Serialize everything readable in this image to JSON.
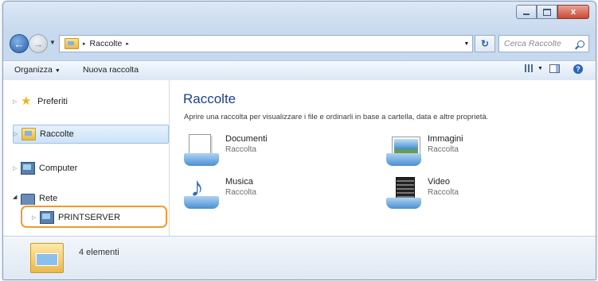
{
  "window": {
    "close_glyph": "x",
    "address": {
      "crumb": "Raccolte",
      "separator": "▸"
    },
    "search": {
      "placeholder": "Cerca Raccolte"
    }
  },
  "toolbar": {
    "organize": "Organizza",
    "new_collection": "Nuova raccolta",
    "dropdown_arrow": "▼"
  },
  "sidebar": {
    "items": [
      {
        "label": "Preferiti",
        "icon": "star-icon"
      },
      {
        "label": "Raccolte",
        "icon": "library-icon",
        "selected": true
      },
      {
        "label": "Computer",
        "icon": "computer-icon"
      },
      {
        "label": "Rete",
        "icon": "network-icon"
      },
      {
        "label": "PRINTSERVER",
        "icon": "computer-icon",
        "highlighted": true
      }
    ]
  },
  "content": {
    "title": "Raccolte",
    "description": "Aprire una raccolta per visualizzare i file e ordinarli in base a cartella, data e altre proprietà.",
    "libraries": [
      {
        "name": "Documenti",
        "type": "Raccolta",
        "icon": "documents-library-icon"
      },
      {
        "name": "Immagini",
        "type": "Raccolta",
        "icon": "pictures-library-icon"
      },
      {
        "name": "Musica",
        "type": "Raccolta",
        "icon": "music-library-icon"
      },
      {
        "name": "Video",
        "type": "Raccolta",
        "icon": "video-library-icon"
      }
    ]
  },
  "details": {
    "count": "4 elementi"
  },
  "colors": {
    "highlight": "#f39a2d",
    "title": "#1e3f8a",
    "selection": "#cde3f8"
  }
}
